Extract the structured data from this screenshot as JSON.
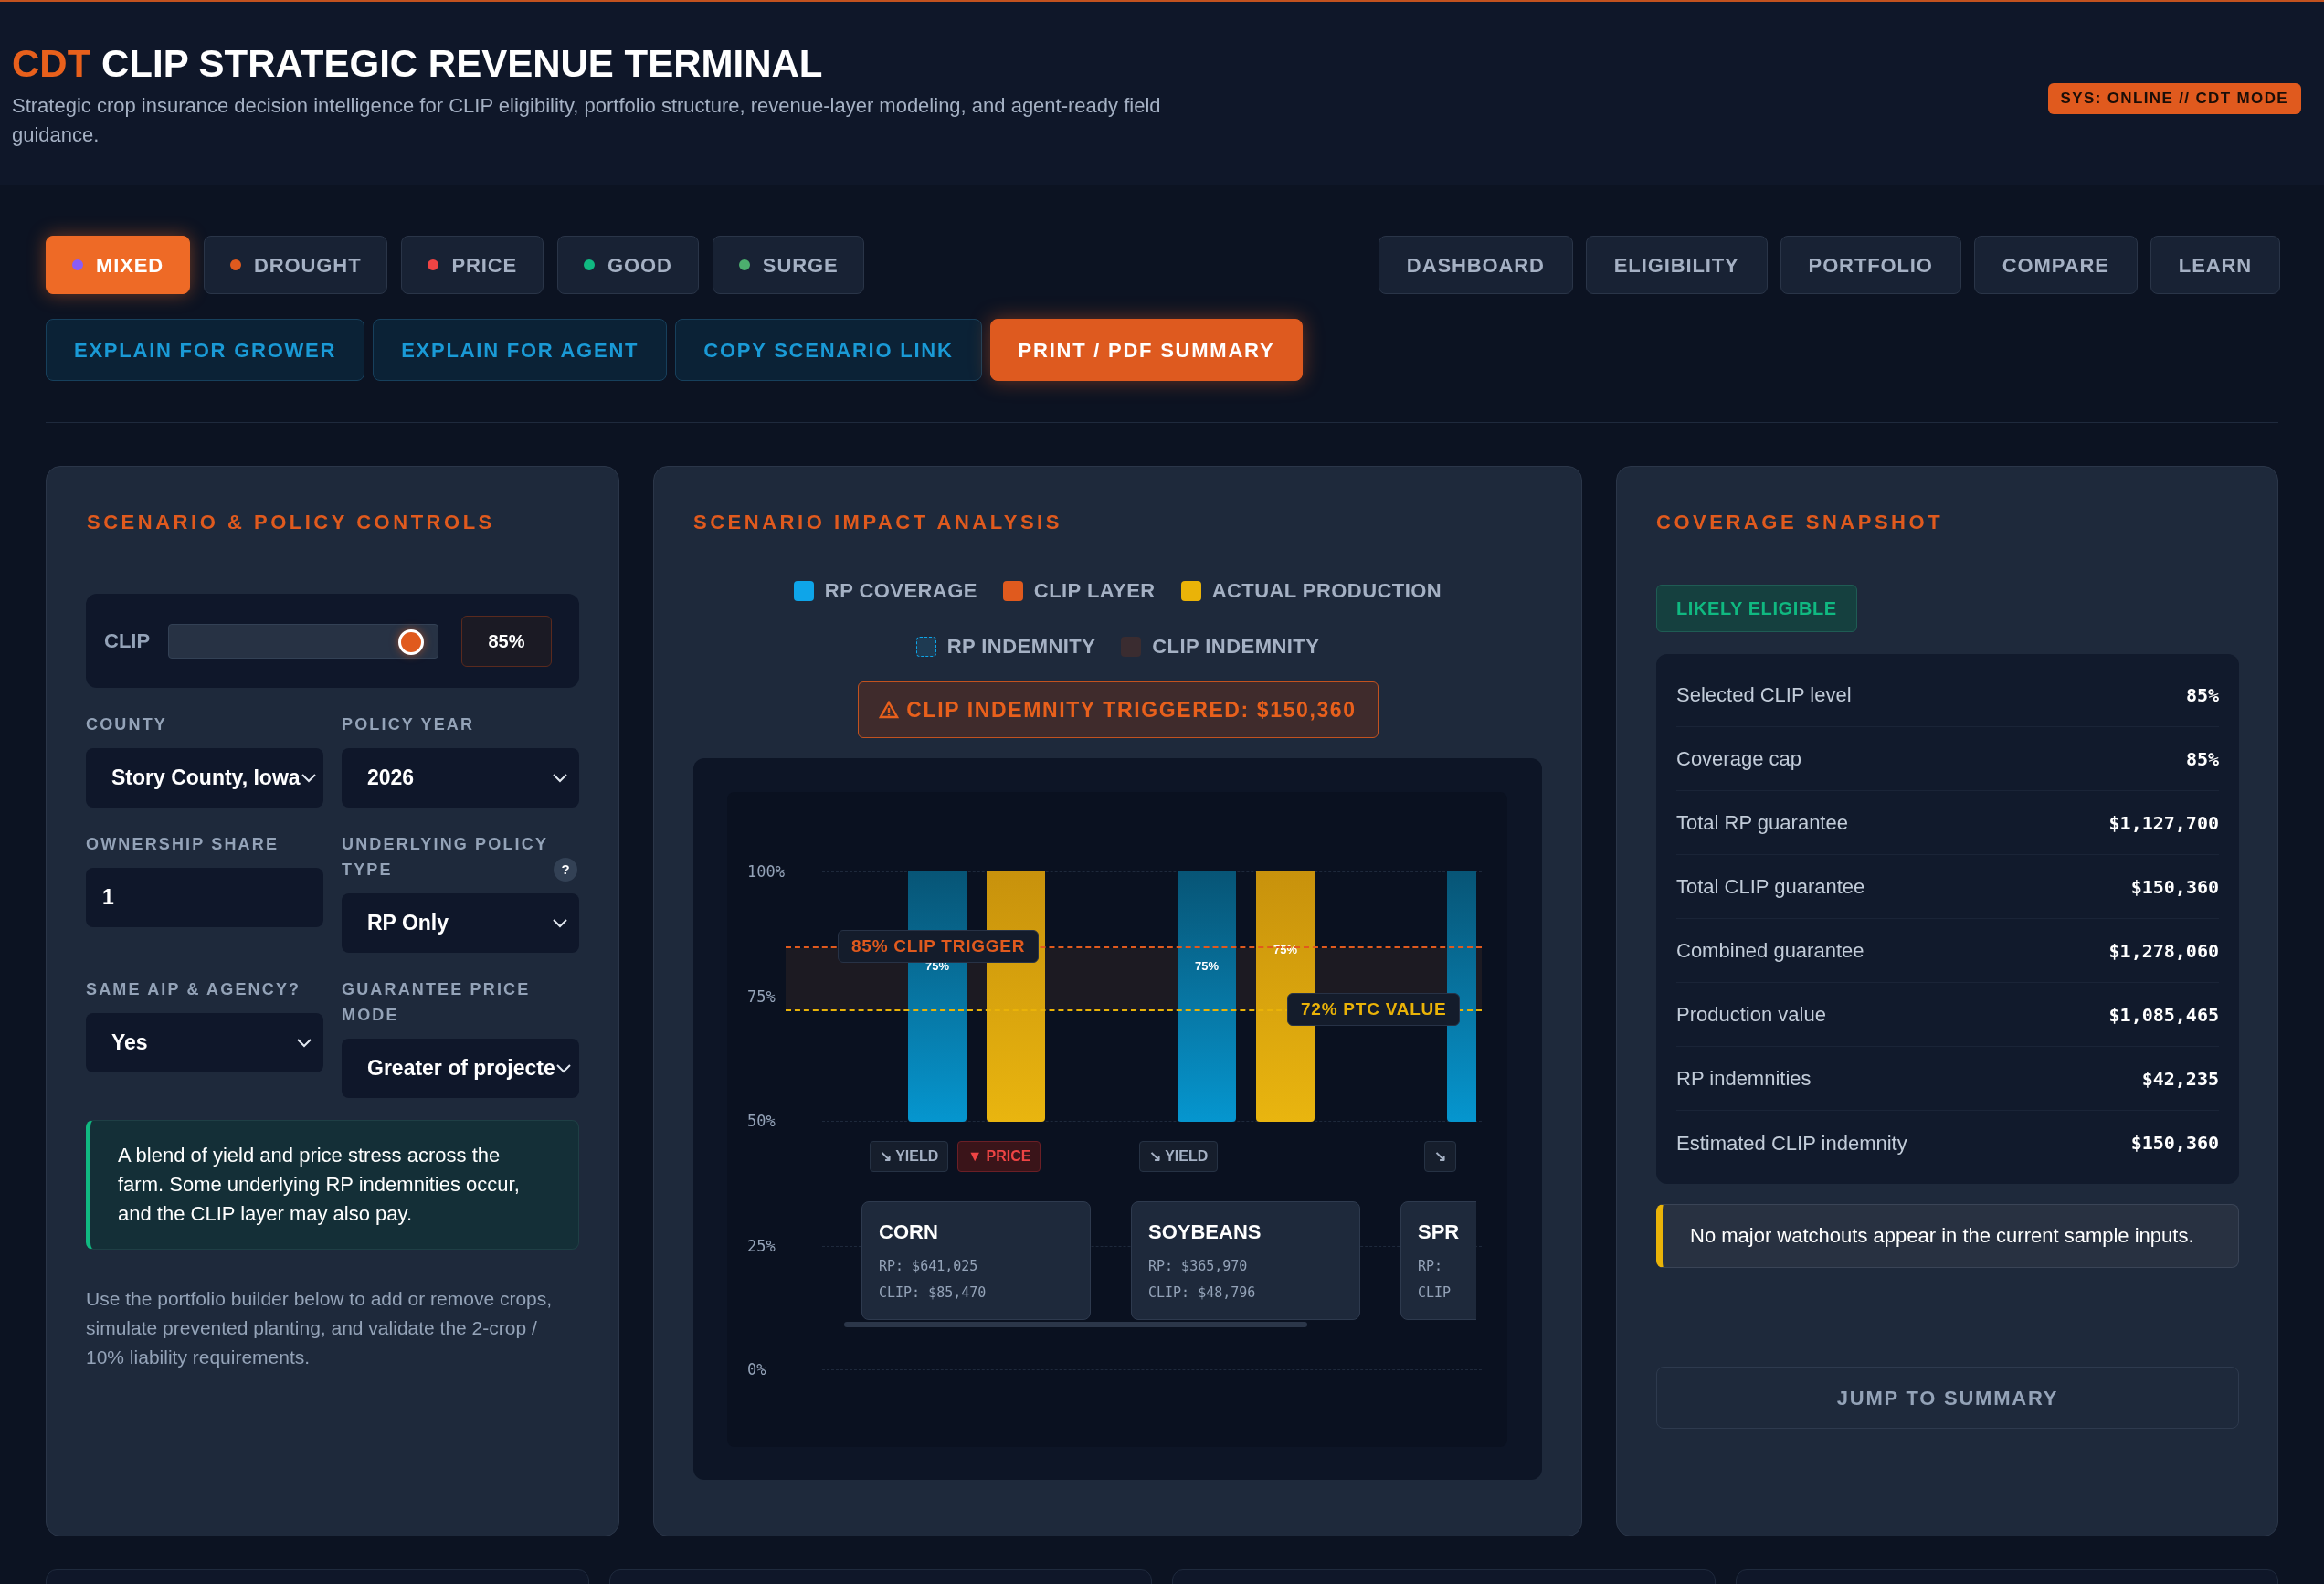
{
  "header": {
    "brand": "CDT",
    "title": "CLIP STRATEGIC REVENUE TERMINAL",
    "subtitle": "Strategic crop insurance decision intelligence for CLIP eligibility, portfolio structure, revenue-layer modeling, and agent-ready field guidance.",
    "status": "SYS: ONLINE // CDT MODE"
  },
  "scenarios": [
    {
      "label": "MIXED",
      "color": "#8b5cf6",
      "selected": true
    },
    {
      "label": "DROUGHT",
      "color": "#e05a1e",
      "selected": false
    },
    {
      "label": "PRICE",
      "color": "#ef4444",
      "selected": false
    },
    {
      "label": "GOOD",
      "color": "#10b981",
      "selected": false
    },
    {
      "label": "SURGE",
      "color": "#4caf6e",
      "selected": false
    }
  ],
  "nav": [
    "DASHBOARD",
    "ELIGIBILITY",
    "PORTFOLIO",
    "COMPARE",
    "LEARN"
  ],
  "actions": [
    {
      "label": "EXPLAIN FOR GROWER",
      "kind": "outline"
    },
    {
      "label": "EXPLAIN FOR AGENT",
      "kind": "outline"
    },
    {
      "label": "COPY SCENARIO LINK",
      "kind": "outline"
    },
    {
      "label": "PRINT / PDF SUMMARY",
      "kind": "primary"
    }
  ],
  "controls": {
    "title": "SCENARIO & POLICY CONTROLS",
    "slider": {
      "label": "CLIP",
      "level": 0.9,
      "value": "85%"
    },
    "fields": [
      {
        "label": "COUNTY",
        "kind": "select",
        "value": "Story County, Iowa"
      },
      {
        "label": "POLICY YEAR",
        "kind": "select",
        "value": "2026"
      },
      {
        "label": "OWNERSHIP SHARE",
        "kind": "input",
        "value": "1"
      },
      {
        "label": "UNDERLYING POLICY TYPE",
        "help": "?",
        "kind": "select",
        "value": "RP Only"
      },
      {
        "label": "SAME AIP & AGENCY?",
        "kind": "select",
        "value": "Yes"
      },
      {
        "label": "GUARANTEE PRICE MODE",
        "kind": "select",
        "value": "Greater of projecte"
      }
    ],
    "info": "A blend of yield and price stress across the farm. Some underlying RP indemnities occur, and the CLIP layer may also pay.",
    "note": "Use the portfolio builder below to add or remove crops, simulate prevented planting, and validate the 2-crop / 10% liability requirements."
  },
  "impact": {
    "title": "SCENARIO IMPACT ANALYSIS",
    "legend": [
      [
        {
          "label": "RP COVERAGE",
          "color": "#0ea5e9",
          "kind": "solid"
        },
        {
          "label": "CLIP LAYER",
          "color": "#e05a1e",
          "kind": "solid"
        },
        {
          "label": "ACTUAL PRODUCTION",
          "color": "#eab308",
          "kind": "solid"
        }
      ],
      [
        {
          "label": "RP INDEMNITY",
          "color": "#1e3a52",
          "kind": "dashed"
        },
        {
          "label": "CLIP INDEMNITY",
          "color": "#3a2c30",
          "kind": "solid"
        }
      ]
    ],
    "alert": "CLIP INDEMNITY TRIGGERED: $150,360",
    "yticks": [
      "100%",
      "75%",
      "50%",
      "25%",
      "0%"
    ],
    "trigger": "85% CLIP TRIGGER",
    "ptc": "72% PTC VALUE",
    "crops": [
      {
        "name": "CORN",
        "bars": [
          {
            "kind": "rp",
            "label": "75%"
          },
          {
            "kind": "actual"
          }
        ],
        "rp": "RP: $641,025",
        "clip": "CLIP: $85,470",
        "tags": [
          {
            "kind": "yield",
            "text": "↘ YIELD"
          },
          {
            "kind": "price",
            "text": "▼ PRICE"
          }
        ]
      },
      {
        "name": "SOYBEANS",
        "bars": [
          {
            "kind": "rp",
            "label": "75%"
          },
          {
            "kind": "actual",
            "label": "75%"
          }
        ],
        "rp": "RP: $365,970",
        "clip": "CLIP: $48,796",
        "tags": [
          {
            "kind": "yield",
            "text": "↘ YIELD"
          }
        ]
      },
      {
        "name": "SPR",
        "bars": [
          {
            "kind": "rp"
          }
        ],
        "rp": "RP:",
        "clip": "CLIP",
        "tags": [
          {
            "kind": "yield",
            "text": "↘"
          }
        ]
      }
    ]
  },
  "snapshot": {
    "title": "COVERAGE SNAPSHOT",
    "badge": "LIKELY ELIGIBLE",
    "rows": [
      {
        "label": "Selected CLIP level",
        "value": "85%"
      },
      {
        "label": "Coverage cap",
        "value": "85%"
      },
      {
        "label": "Total RP guarantee",
        "value": "$1,127,700"
      },
      {
        "label": "Total CLIP guarantee",
        "value": "$150,360"
      },
      {
        "label": "Combined guarantee",
        "value": "$1,278,060"
      },
      {
        "label": "Production value",
        "value": "$1,085,465"
      },
      {
        "label": "RP indemnities",
        "value": "$42,235"
      },
      {
        "label": "Estimated CLIP indemnity",
        "value": "$150,360"
      }
    ],
    "note": "No major watchouts appear in the current sample inputs.",
    "button": "JUMP TO SUMMARY"
  }
}
